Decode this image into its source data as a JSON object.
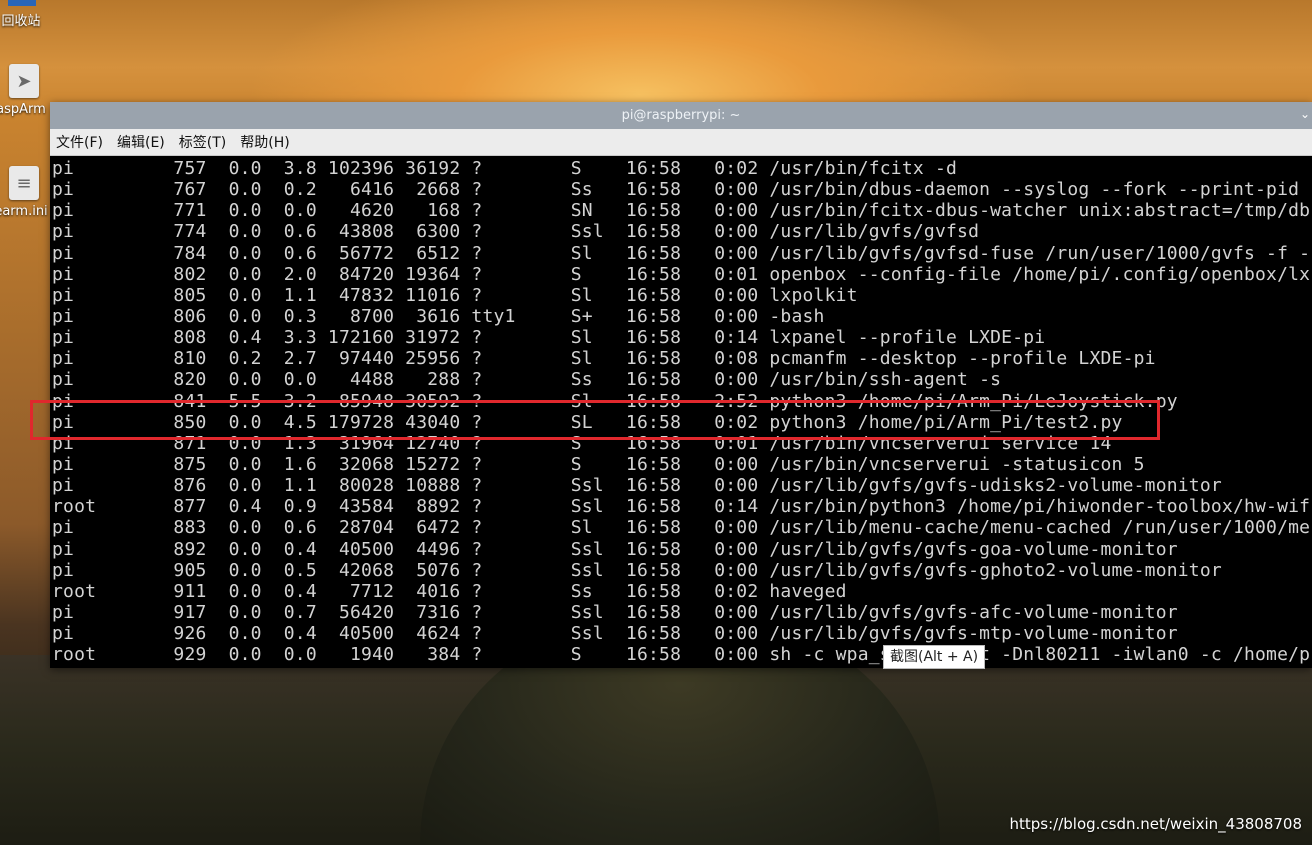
{
  "desktop": {
    "icons": [
      {
        "name": "recycle-bin-icon",
        "label": "回收站"
      },
      {
        "name": "rasparm-icon",
        "label": "aspArm"
      },
      {
        "name": "learn-file-icon",
        "label": "earm.ini"
      }
    ],
    "watermark": "https://blog.csdn.net/weixin_43808708"
  },
  "window": {
    "title": "pi@raspberrypi: ~",
    "menu": [
      "文件(F)",
      "编辑(E)",
      "标签(T)",
      "帮助(H)"
    ]
  },
  "terminal": {
    "lines": [
      "pi         757  0.0  3.8 102396 36192 ?        S    16:58   0:02 /usr/bin/fcitx -d",
      "pi         767  0.0  0.2   6416  2668 ?        Ss   16:58   0:00 /usr/bin/dbus-daemon --syslog --fork --print-pid",
      "pi         771  0.0  0.0   4620   168 ?        SN   16:58   0:00 /usr/bin/fcitx-dbus-watcher unix:abstract=/tmp/db",
      "pi         774  0.0  0.6  43808  6300 ?        Ssl  16:58   0:00 /usr/lib/gvfs/gvfsd",
      "pi         784  0.0  0.6  56772  6512 ?        Sl   16:58   0:00 /usr/lib/gvfs/gvfsd-fuse /run/user/1000/gvfs -f -",
      "pi         802  0.0  2.0  84720 19364 ?        S    16:58   0:01 openbox --config-file /home/pi/.config/openbox/lx",
      "pi         805  0.0  1.1  47832 11016 ?        Sl   16:58   0:00 lxpolkit",
      "pi         806  0.0  0.3   8700  3616 tty1     S+   16:58   0:00 -bash",
      "pi         808  0.4  3.3 172160 31972 ?        Sl   16:58   0:14 lxpanel --profile LXDE-pi",
      "pi         810  0.2  2.7  97440 25956 ?        Sl   16:58   0:08 pcmanfm --desktop --profile LXDE-pi",
      "pi         820  0.0  0.0   4488   288 ?        Ss   16:58   0:00 /usr/bin/ssh-agent -s",
      "pi         841  5.5  3.2  85948 30592 ?        Sl   16:58   2:52 python3 /home/pi/Arm_Pi/LeJoystick.py",
      "pi         850  0.0  4.5 179728 43040 ?        SL   16:58   0:02 python3 /home/pi/Arm_Pi/test2.py",
      "pi         871  0.0  1.3  31964 12740 ?        S    16:58   0:01 /usr/bin/vncserverui service 14",
      "pi         875  0.0  1.6  32068 15272 ?        S    16:58   0:00 /usr/bin/vncserverui -statusicon 5",
      "pi         876  0.0  1.1  80028 10888 ?        Ssl  16:58   0:00 /usr/lib/gvfs/gvfs-udisks2-volume-monitor",
      "root       877  0.4  0.9  43584  8892 ?        Ssl  16:58   0:14 /usr/bin/python3 /home/pi/hiwonder-toolbox/hw-wif",
      "pi         883  0.0  0.6  28704  6472 ?        Sl   16:58   0:00 /usr/lib/menu-cache/menu-cached /run/user/1000/me",
      "pi         892  0.0  0.4  40500  4496 ?        Ssl  16:58   0:00 /usr/lib/gvfs/gvfs-goa-volume-monitor",
      "pi         905  0.0  0.5  42068  5076 ?        Ssl  16:58   0:00 /usr/lib/gvfs/gvfs-gphoto2-volume-monitor",
      "root       911  0.0  0.4   7712  4016 ?        Ss   16:58   0:02 haveged",
      "pi         917  0.0  0.7  56420  7316 ?        Ssl  16:58   0:00 /usr/lib/gvfs/gvfs-afc-volume-monitor",
      "pi         926  0.0  0.4  40500  4624 ?        Ssl  16:58   0:00 /usr/lib/gvfs/gvfs-mtp-volume-monitor",
      "root       929  0.0  0.0   1940   384 ?        S    16:58   0:00 sh -c wpa_supplicant -Dnl80211 -iwlan0 -c /home/p"
    ]
  },
  "tooltip": "截图(Alt + A)",
  "highlight_color": "#e0282d"
}
